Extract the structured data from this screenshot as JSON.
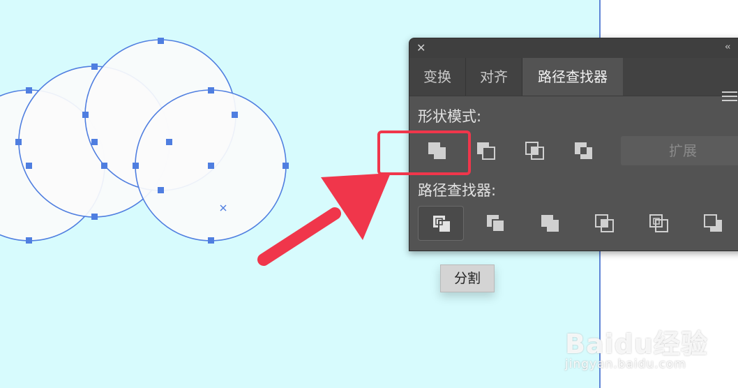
{
  "panel": {
    "close_glyph": "✕",
    "collapse_glyph": "‹‹",
    "tabs": [
      {
        "label": "变换"
      },
      {
        "label": "对齐"
      },
      {
        "label": "路径查找器"
      }
    ],
    "active_tab": "路径查找器",
    "shape_modes_label": "形状模式:",
    "pathfinders_label": "路径查找器:",
    "expand_label": "扩展",
    "icons": {
      "shape_modes": [
        "unite-icon",
        "minus-front-icon",
        "intersect-icon",
        "exclude-icon"
      ],
      "pathfinders": [
        "divide-icon",
        "trim-icon",
        "merge-icon",
        "crop-icon",
        "outline-icon",
        "minus-back-icon"
      ]
    }
  },
  "tooltip": {
    "text": "分割"
  },
  "watermark": {
    "logo": "Baidu经验",
    "url": "jingyan.baidu.com"
  },
  "colors": {
    "artboard": "#d7fbfd",
    "selection": "#4f7ee0",
    "panel": "#535353",
    "highlight": "#f0364b"
  }
}
